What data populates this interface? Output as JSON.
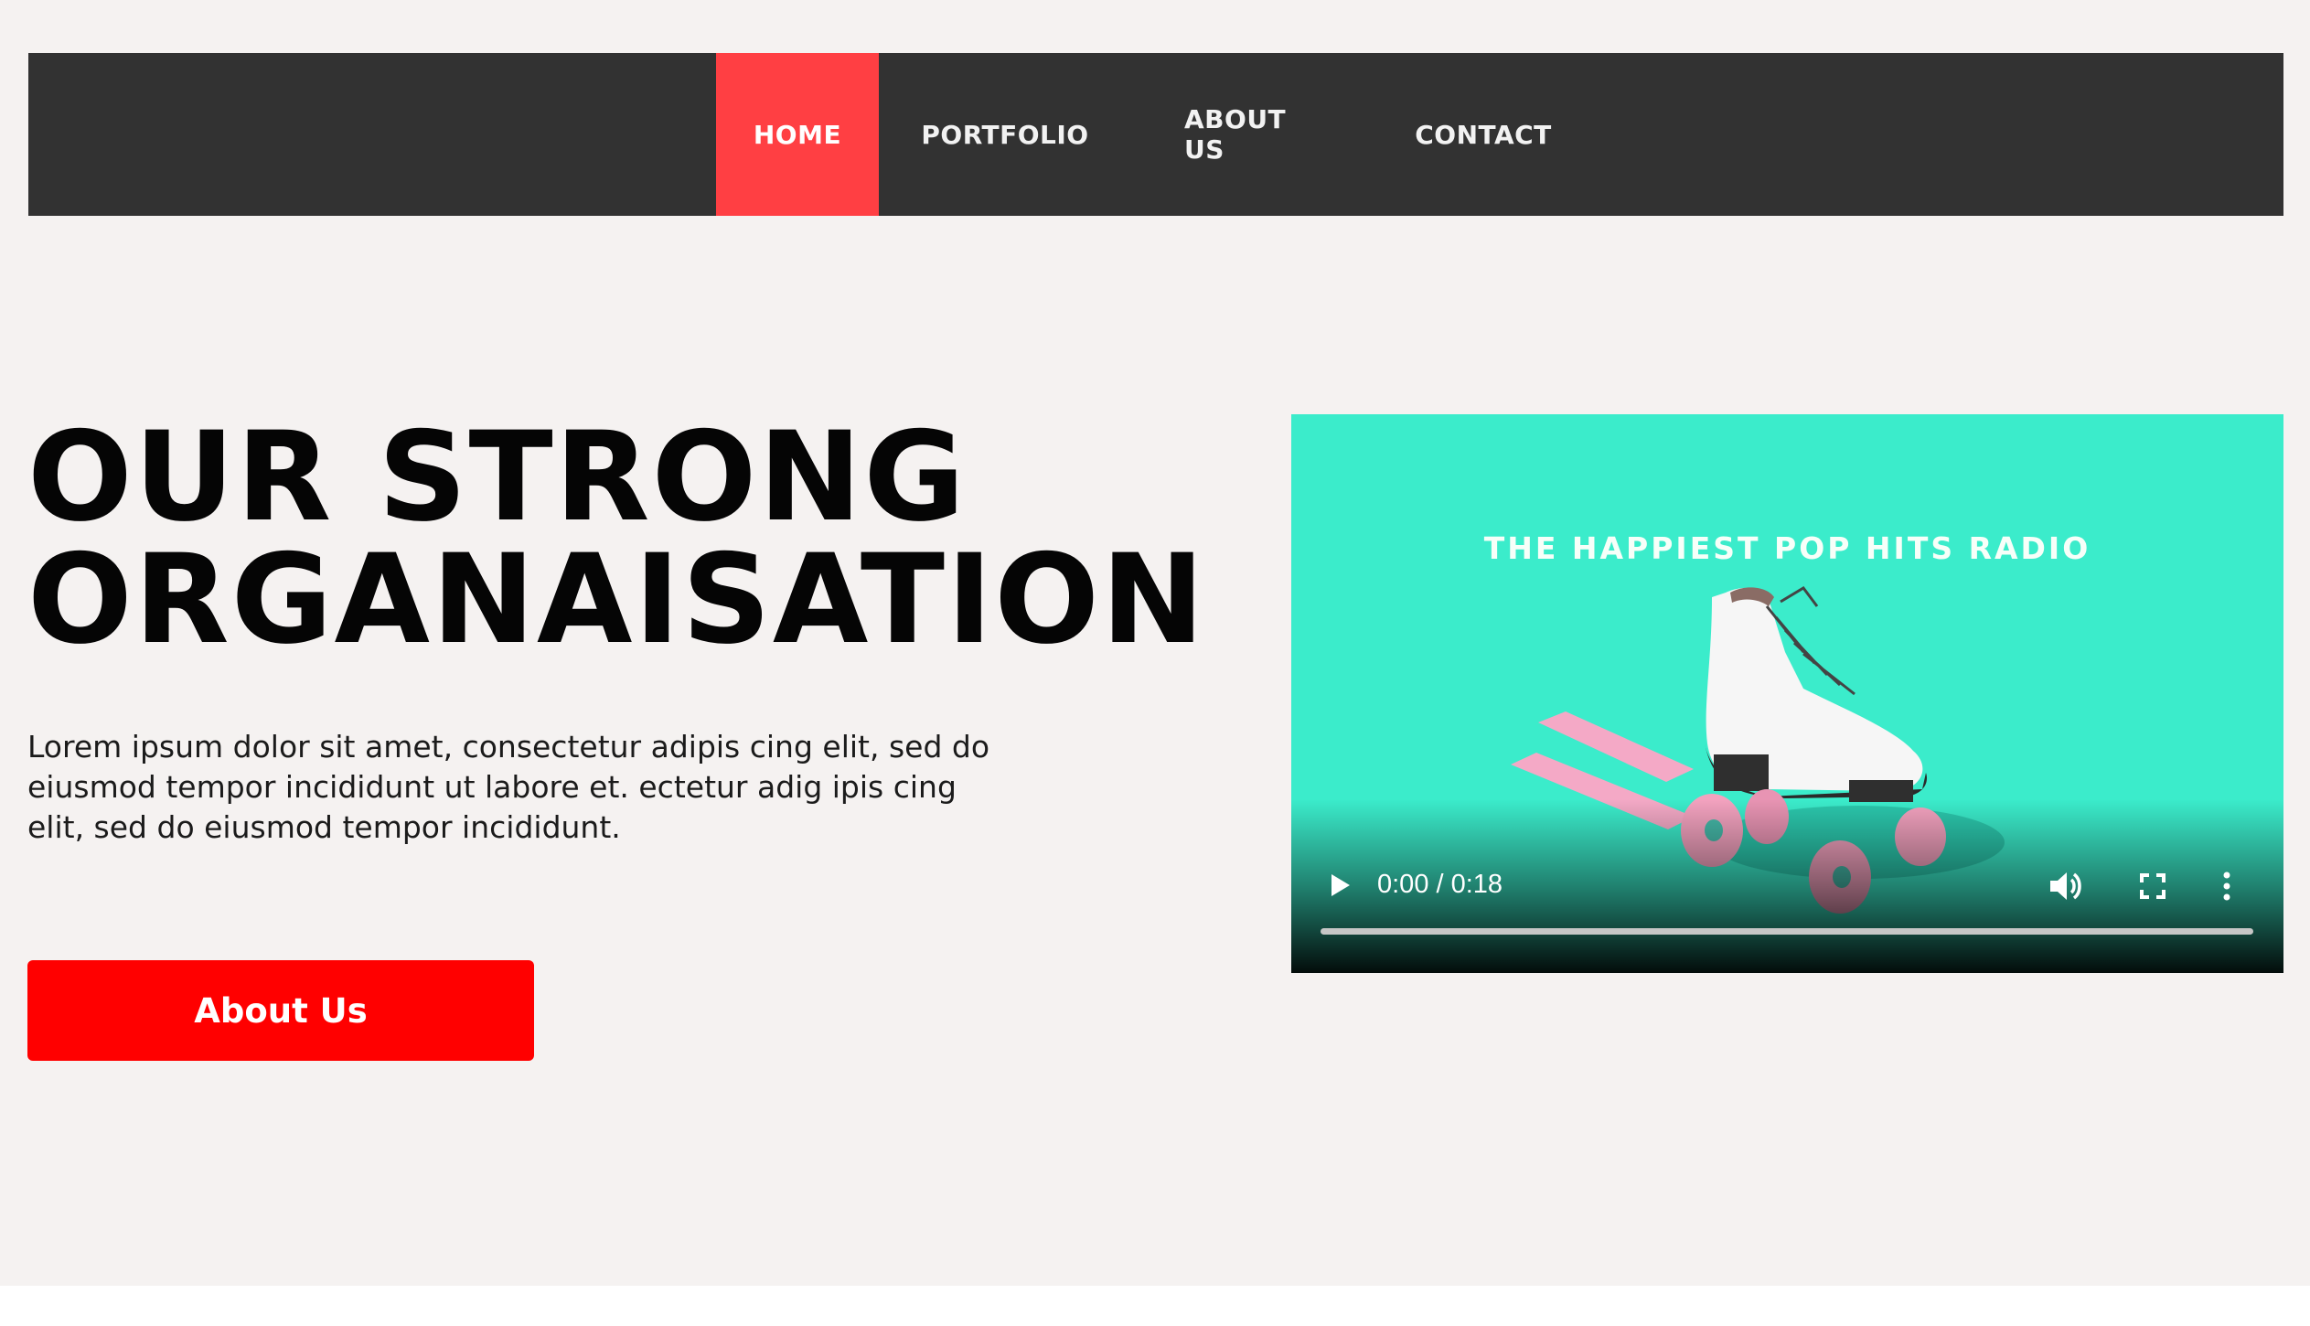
{
  "nav": {
    "items": [
      {
        "label": "HOME",
        "active": true
      },
      {
        "label": "PORTFOLIO",
        "active": false
      },
      {
        "label": "ABOUT US",
        "active": false
      },
      {
        "label": "CONTACT",
        "active": false
      }
    ],
    "active_color": "#ff3f43",
    "bar_color": "#323232"
  },
  "hero": {
    "title_line1": "OUR STRONG",
    "title_line2": "ORGANAISATION",
    "body": "Lorem ipsum dolor sit amet, consectetur adipis cing elit, sed do eiusmod tempor incididunt ut labore et. ectetur adig ipis cing elit, sed do eiusmod tempor incididunt.",
    "button_label": "About Us",
    "button_color": "#ff0000"
  },
  "video": {
    "caption": "THE HAPPIEST POP HITS RADIO",
    "time": "0:00 / 0:18",
    "progress": 0,
    "background_color": "#3beccb",
    "icons": [
      "play-icon",
      "volume-icon",
      "fullscreen-icon",
      "more-vert-icon"
    ]
  }
}
